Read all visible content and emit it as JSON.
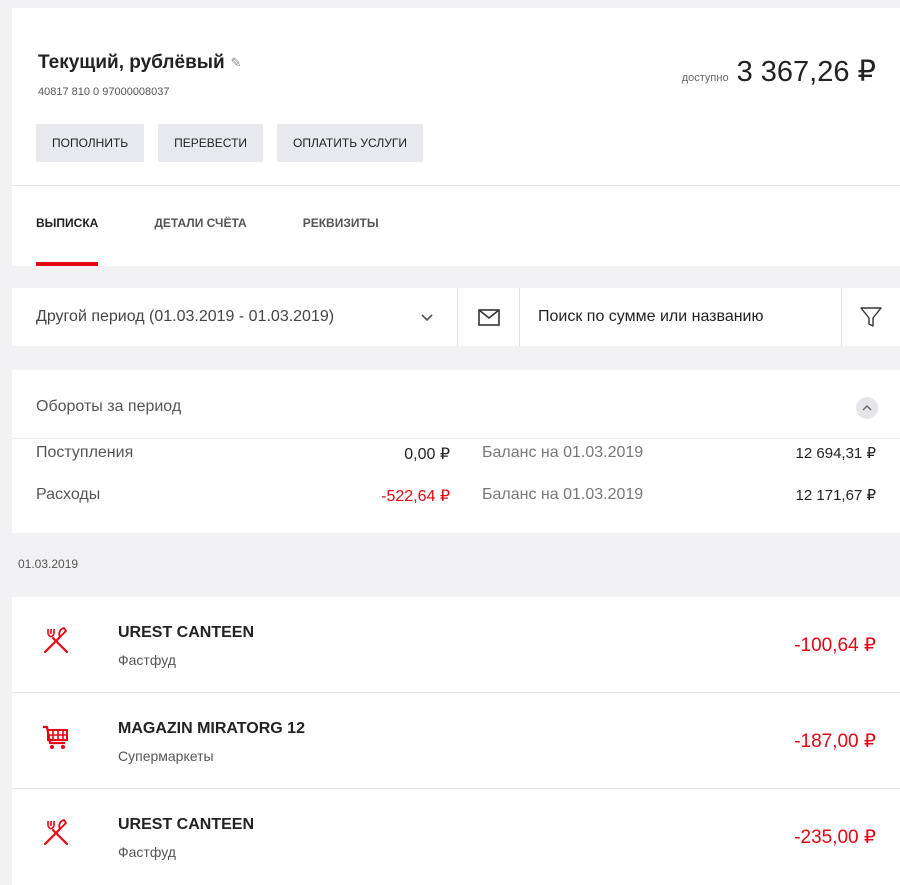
{
  "account": {
    "title": "Текущий, рублёвый",
    "edit_glyph": "✎",
    "number": "40817 810 0 97000008037",
    "available_label": "доступно",
    "available_amount": "3 367,26 ₽",
    "actions": [
      "ПОПОЛНИТЬ",
      "ПЕРЕВЕСТИ",
      "ОПЛАТИТЬ УСЛУГИ"
    ],
    "tabs": [
      {
        "label": "ВЫПИСКА",
        "active": true
      },
      {
        "label": "ДЕТАЛИ СЧЁТА",
        "active": false
      },
      {
        "label": "РЕКВИЗИТЫ",
        "active": false
      }
    ]
  },
  "filters": {
    "period_value": "Другой период (01.03.2019 - 01.03.2019)",
    "search_placeholder": "Поиск по сумме или названию"
  },
  "turnover": {
    "title": "Обороты за период",
    "rows": [
      {
        "label": "Поступления",
        "value": "0,00 ₽",
        "balance_label": "Баланс на 01.03.2019",
        "balance_value": "12 694,31 ₽"
      },
      {
        "label": "Расходы",
        "value": "-522,64 ₽",
        "balance_label": "Баланс на 01.03.2019",
        "balance_value": "12 171,67 ₽"
      }
    ]
  },
  "date_header": "01.03.2019",
  "transactions": [
    {
      "name": "UREST CANTEEN",
      "category": "Фастфуд",
      "amount": "-100,64 ₽",
      "icon": "fork-knife-icon"
    },
    {
      "name": "MAGAZIN MIRATORG 12",
      "category": "Супермаркеты",
      "amount": "-187,00 ₽",
      "icon": "shopping-cart-icon"
    },
    {
      "name": "UREST CANTEEN",
      "category": "Фастфуд",
      "amount": "-235,00 ₽",
      "icon": "fork-knife-icon"
    }
  ],
  "colors": {
    "accent": "#e30613",
    "button_bg": "#e8e9ed",
    "page_bg": "#f2f2f4"
  }
}
